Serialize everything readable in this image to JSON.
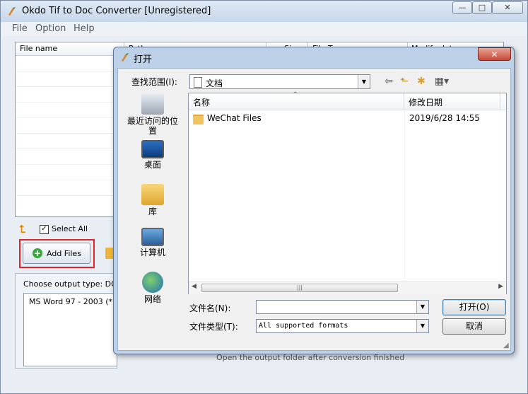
{
  "main": {
    "title": "Okdo Tif to Doc Converter [Unregistered]",
    "window_buttons": {
      "minimize": "—",
      "maximize": "□",
      "close": "✕"
    },
    "menu": [
      "File",
      "Option",
      "Help"
    ],
    "filelist": {
      "columns": [
        "File name",
        "Path",
        "Size",
        "File Type",
        "Modify date"
      ]
    },
    "select_all_label": "Select All",
    "add_files_label": "Add Files",
    "output_type_label": "Choose output type:  DOC",
    "output_item": "MS Word 97 - 2003 (*",
    "bottom_peek": "Open the output folder after conversion finished"
  },
  "dialog": {
    "title": "打开",
    "look_in_label": "查找范围(I):",
    "look_in_value": "文档",
    "places": [
      "最近访问的位置",
      "桌面",
      "库",
      "计算机",
      "网络"
    ],
    "columns": {
      "name": "名称",
      "date": "修改日期"
    },
    "files": [
      {
        "name": "WeChat Files",
        "date": "2019/6/28 14:55"
      }
    ],
    "filename_label": "文件名(N):",
    "filename_value": "",
    "filetype_label": "文件类型(T):",
    "filetype_value": "All supported formats",
    "open_label": "打开(O)",
    "cancel_label": "取消"
  },
  "colors": {
    "highlight": "#e0262c",
    "title_bar": "#c7d7ea",
    "dialog_frame": "#bcd0e8"
  }
}
